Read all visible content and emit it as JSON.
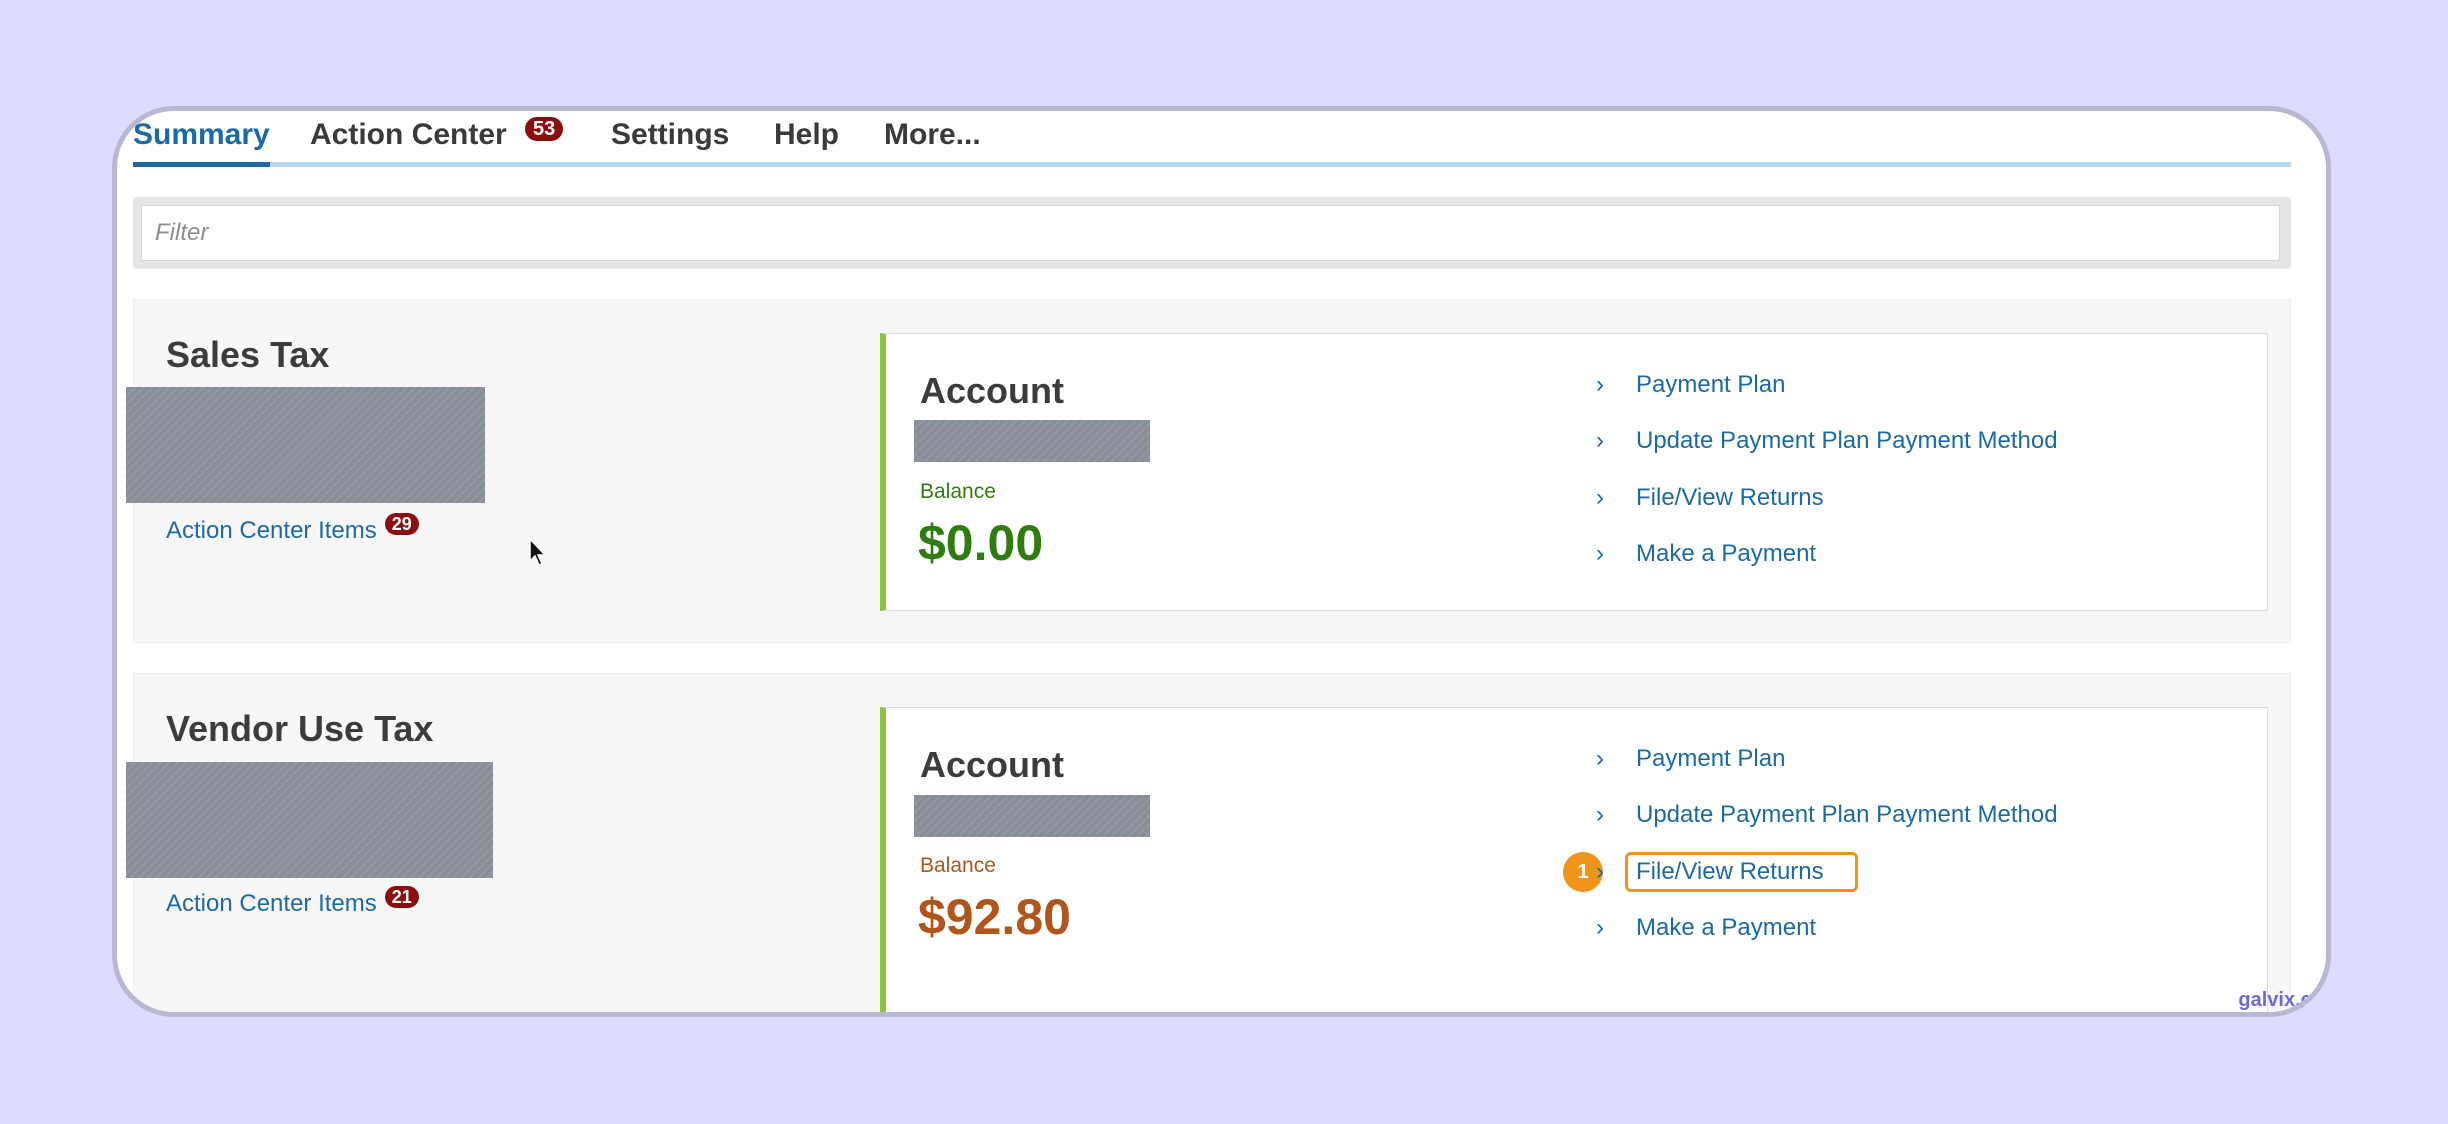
{
  "tabs": [
    {
      "label": "Summary",
      "active": true
    },
    {
      "label": "Action Center",
      "badge": "53"
    },
    {
      "label": "Settings"
    },
    {
      "label": "Help"
    },
    {
      "label": "More..."
    }
  ],
  "filter": {
    "placeholder": "Filter"
  },
  "sections": [
    {
      "title": "Sales Tax",
      "action_center_label": "Action Center Items",
      "action_center_count": "29",
      "account_title": "Account",
      "balance_label": "Balance",
      "balance": "$0.00",
      "balance_color": "#2f7d10",
      "links": [
        "Payment Plan",
        "Update Payment Plan Payment Method",
        "File/View Returns",
        "Make a Payment"
      ]
    },
    {
      "title": "Vendor Use Tax",
      "action_center_label": "Action Center Items",
      "action_center_count": "21",
      "account_title": "Account",
      "balance_label": "Balance",
      "balance": "$92.80",
      "balance_color": "#b0561d",
      "links": [
        "Payment Plan",
        "Update Payment Plan Payment Method",
        "File/View Returns",
        "Make a Payment"
      ],
      "highlighted_link": "File/View Returns",
      "step_number": "1"
    }
  ],
  "colors": {
    "accent": "#1b6aa5",
    "highlight": "#f0941a",
    "card_border": "#8cc23f"
  },
  "watermark": "galvix.co"
}
